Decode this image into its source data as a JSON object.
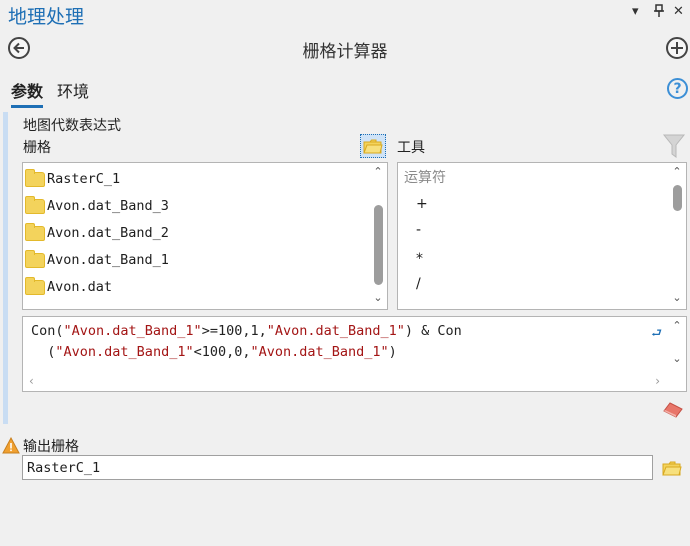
{
  "pane": {
    "title": "地理处理",
    "dropdown_glyph": "▾",
    "pin_glyph": "📌",
    "close_glyph": "✕"
  },
  "tool": {
    "title": "栅格计算器",
    "back_glyph": "←",
    "add_glyph": "+"
  },
  "tabs": [
    {
      "label": "参数",
      "active": true
    },
    {
      "label": "环境",
      "active": false
    }
  ],
  "help_glyph": "?",
  "params": {
    "expression_label": "地图代数表达式",
    "raster_label": "栅格",
    "tools_label": "工具",
    "rasters": [
      "RasterC_1",
      "Avon.dat_Band_3",
      "Avon.dat_Band_2",
      "Avon.dat_Band_1",
      "Avon.dat"
    ],
    "operators_heading": "运算符",
    "operators": [
      "+",
      "-",
      "*",
      "/"
    ],
    "expression_segments": [
      {
        "text": "Con(",
        "type": "plain"
      },
      {
        "text": "\"Avon.dat_Band_1\"",
        "type": "string"
      },
      {
        "text": ">=100,1,",
        "type": "plain"
      },
      {
        "text": "\"Avon.dat_Band_1\"",
        "type": "string"
      },
      {
        "text": ") & Con\n  (",
        "type": "plain"
      },
      {
        "text": "\"Avon.dat_Band_1\"",
        "type": "string"
      },
      {
        "text": "<100,0,",
        "type": "plain"
      },
      {
        "text": "\"Avon.dat_Band_1\"",
        "type": "string"
      },
      {
        "text": ")",
        "type": "plain"
      }
    ],
    "output_label": "输出栅格",
    "output_value": "RasterC_1"
  },
  "scroll": {
    "up": "⌃",
    "down": "⌄",
    "left": "‹",
    "right": "›",
    "wrap": "⮐"
  },
  "icons": {
    "folder_color": "#f3d35c",
    "accent": "#1e6fb5",
    "warning_color": "#f0a030",
    "eraser_color": "#e8766a"
  }
}
